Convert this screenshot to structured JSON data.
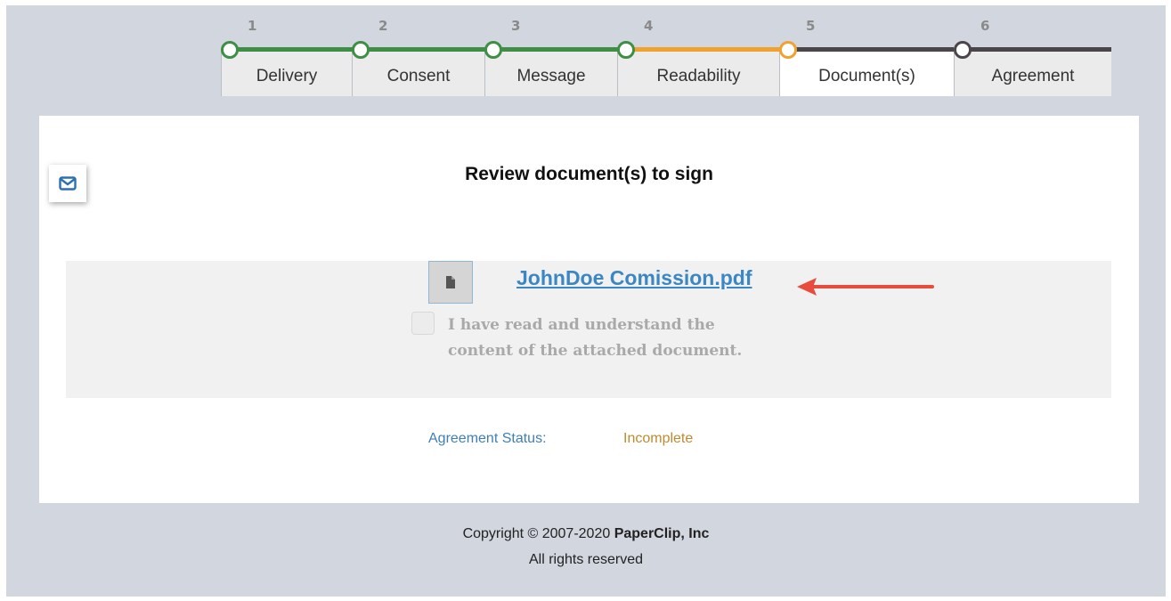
{
  "stepper": {
    "steps": [
      {
        "number": "1",
        "label": "Delivery",
        "state": "complete"
      },
      {
        "number": "2",
        "label": "Consent",
        "state": "complete"
      },
      {
        "number": "3",
        "label": "Message",
        "state": "complete"
      },
      {
        "number": "4",
        "label": "Readability",
        "state": "complete"
      },
      {
        "number": "5",
        "label": "Document(s)",
        "state": "current"
      },
      {
        "number": "6",
        "label": "Agreement",
        "state": "pending"
      }
    ],
    "colors": {
      "complete": "#3e8e46",
      "current": "#f0a22e",
      "pending": "#4a4548"
    }
  },
  "side": {
    "mail_icon": "envelope-icon"
  },
  "main": {
    "title": "Review document(s) to sign",
    "document": {
      "icon": "file-icon",
      "filename": "JohnDoe Comission.pdf"
    },
    "acknowledgement": "I have read and understand the content of the attached document.",
    "acknowledged": false,
    "status": {
      "label": "Agreement Status:",
      "value": "Incomplete"
    }
  },
  "footer": {
    "copyright_prefix": "Copyright © 2007-2020 ",
    "company": "PaperClip, Inc",
    "rights": "All rights reserved"
  }
}
